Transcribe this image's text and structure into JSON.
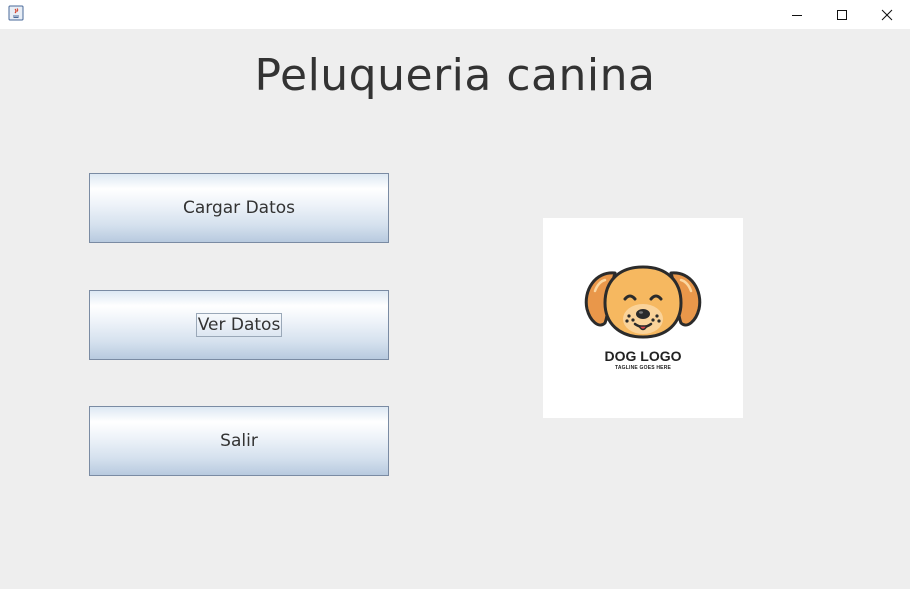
{
  "window": {
    "title": "",
    "controls": {
      "minimize_icon": "minimize-icon",
      "maximize_icon": "maximize-icon",
      "close_icon": "close-icon"
    }
  },
  "header": {
    "title": "Peluqueria canina"
  },
  "buttons": {
    "cargar": "Cargar Datos",
    "ver": "Ver Datos",
    "salir": "Salir"
  },
  "logo": {
    "icon": "dog-face-icon",
    "title": "DOG LOGO",
    "tagline": "TAGLINE GOES HERE"
  },
  "colors": {
    "background": "#eeeeee",
    "titlebar": "#ffffff",
    "button_border": "#7a8ba3",
    "dog_fur": "#f6b860",
    "dog_ears": "#e9974a",
    "outline": "#2b2b2b"
  }
}
